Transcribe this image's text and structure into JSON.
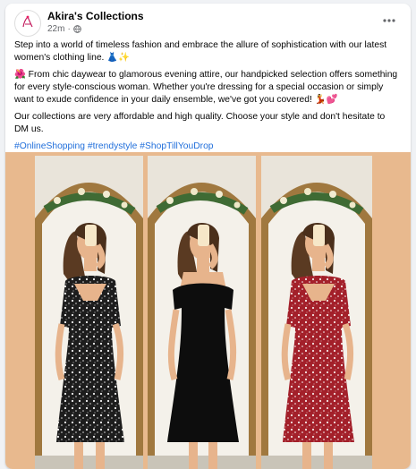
{
  "post": {
    "page_name": "Akira's Collections",
    "avatar_text": "Akira's Collections",
    "time": "22m",
    "separator": "·",
    "icons": {
      "privacy": "globe-icon",
      "more": "more-options-icon"
    },
    "paragraphs": [
      "Step into a world of timeless fashion and embrace the allure of sophistication with our latest women's clothing line. 👗✨",
      "🌺 From chic daywear to glamorous evening attire, our handpicked selection offers something for every style-conscious woman. Whether you're dressing for a special occasion or simply want to exude confidence in your daily ensemble, we've got you covered! 💃💕",
      "Our collections are very affordable and high quality. Choose your style and don't hesitate to DM us."
    ],
    "hashtags": [
      "#OnlineShopping",
      "#trendystyle",
      "#ShopTillYouDrop"
    ]
  },
  "colors": {
    "link": "#216fdb",
    "media_bg": "#e8b98e",
    "dress_floral_black": "#1d1d1d",
    "dress_black": "#0d0d0d",
    "dress_floral_red": "#a3202a"
  }
}
